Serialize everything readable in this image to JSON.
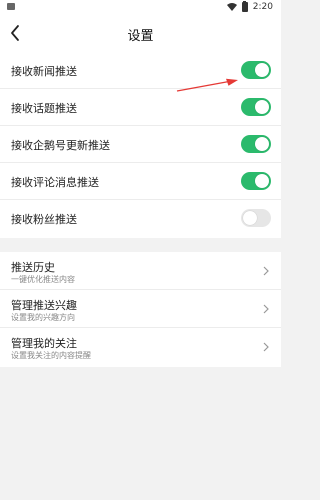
{
  "status_bar": {
    "time": "2:20"
  },
  "header": {
    "title": "设置",
    "back_icon": "chevron-left-icon"
  },
  "push_settings": [
    {
      "label": "接收新闻推送",
      "enabled": true
    },
    {
      "label": "接收话题推送",
      "enabled": true
    },
    {
      "label": "接收企鹅号更新推送",
      "enabled": true
    },
    {
      "label": "接收评论消息推送",
      "enabled": true
    },
    {
      "label": "接收粉丝推送",
      "enabled": false
    }
  ],
  "links": [
    {
      "title": "推送历史",
      "subtitle": "一键优化推送内容"
    },
    {
      "title": "管理推送兴趣",
      "subtitle": "设置我的兴趣方向"
    },
    {
      "title": "管理我的关注",
      "subtitle": "设置我关注的内容提醒"
    }
  ],
  "colors": {
    "accent": "#2bba6c",
    "toggle_off": "#e6e6e6",
    "annotation": "#e53935",
    "background": "#f2f2f2"
  }
}
